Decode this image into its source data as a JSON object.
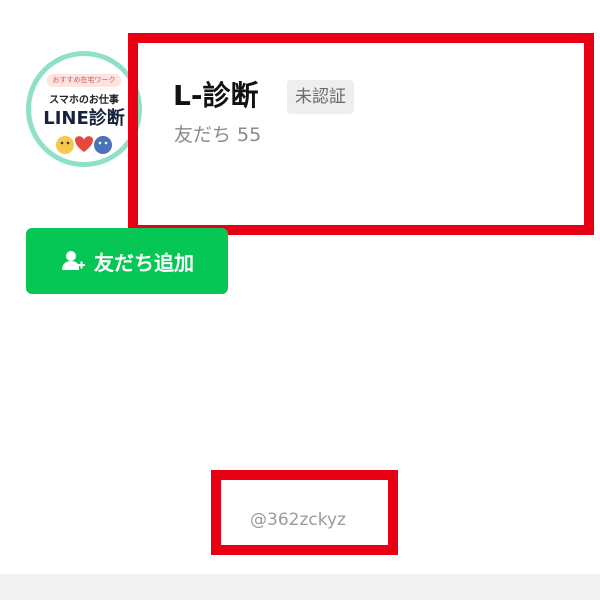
{
  "avatar": {
    "badge_text": "おすすめ在宅ワーク",
    "line1": "スマホのお仕事",
    "line2": "LINE診断",
    "ring_color": "#8fe0c9"
  },
  "profile": {
    "name": "L-診断",
    "verification_badge": "未認証",
    "friends_text": "友だち 55"
  },
  "add_friend": {
    "label": "友だち追加",
    "icon": "add-friend-icon",
    "color": "#06c755"
  },
  "line_id": "@362zckyz",
  "highlight_color": "#e60012"
}
